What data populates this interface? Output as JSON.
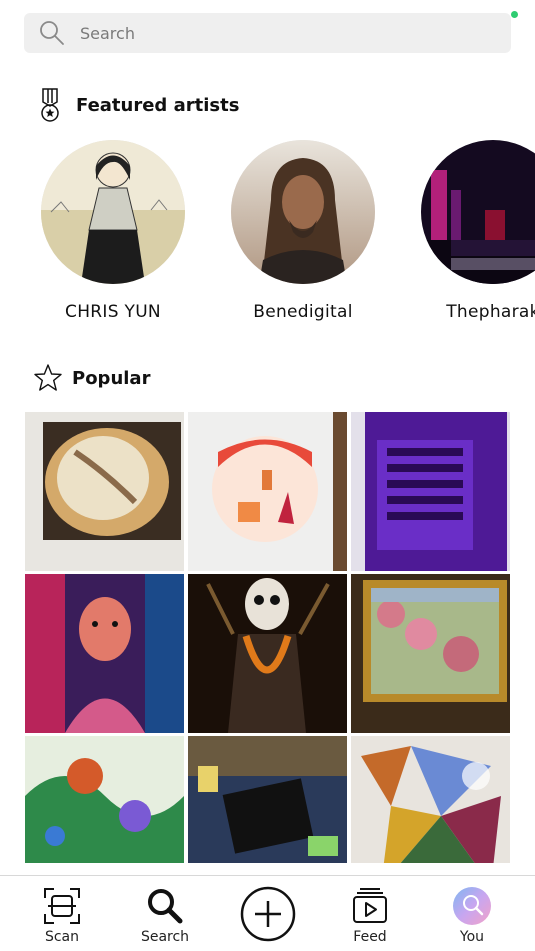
{
  "search": {
    "placeholder": "Search",
    "icon": "search-icon"
  },
  "featured": {
    "title": "Featured artists",
    "icon": "medal-icon",
    "artists": [
      {
        "name": "CHRIS YUN"
      },
      {
        "name": "Benedigital"
      },
      {
        "name": "Thepharak"
      }
    ]
  },
  "popular": {
    "title": "Popular",
    "icon": "star-icon"
  },
  "tabbar": {
    "tabs": [
      {
        "label": "Scan",
        "icon": "scan-icon"
      },
      {
        "label": "Search",
        "icon": "search-icon"
      },
      {
        "label": "",
        "icon": "add-circle-icon"
      },
      {
        "label": "Feed",
        "icon": "feed-icon"
      },
      {
        "label": "You",
        "icon": "profile-avatar-icon"
      }
    ]
  },
  "colors": {
    "status_dot": "#2ecc71",
    "search_bg": "#efefef"
  }
}
